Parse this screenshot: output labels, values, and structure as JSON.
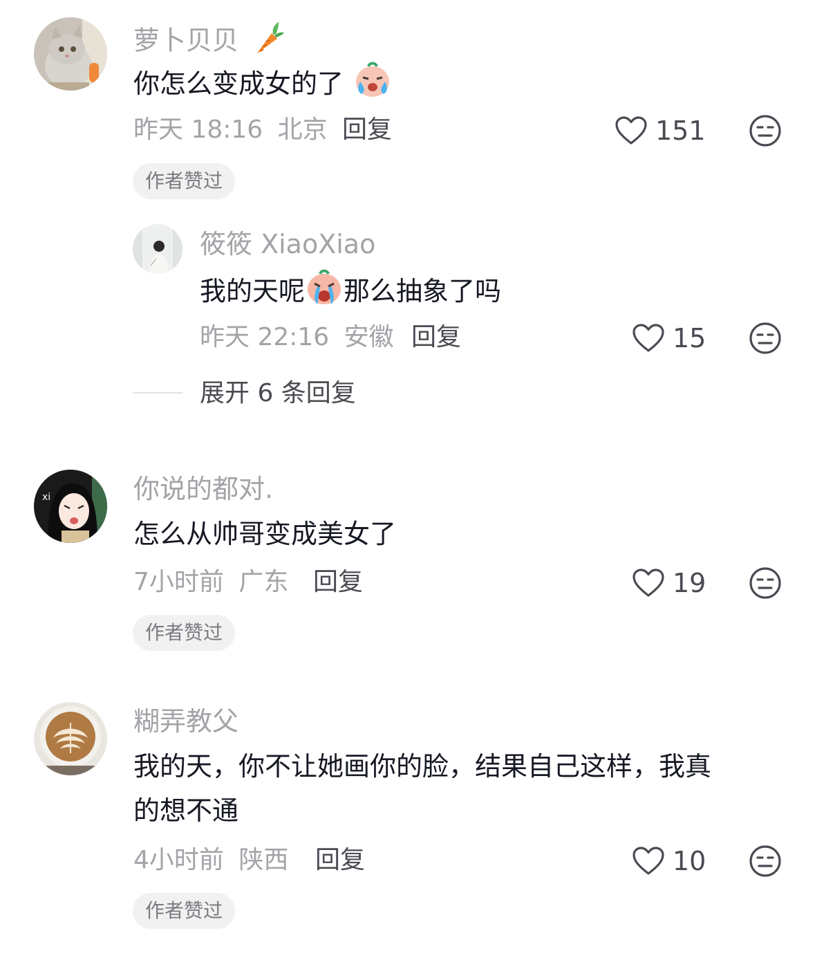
{
  "comments": [
    {
      "username": "萝卜贝贝",
      "text": "你怎么变成女的了",
      "time": "昨天 18:16",
      "location": "北京",
      "reply_label": "回复",
      "likes": "151",
      "badge": "作者赞过"
    },
    {
      "username": "你说的都对.",
      "text": "怎么从帅哥变成美女了",
      "time": "7小时前",
      "location": "广东",
      "reply_label": "回复",
      "likes": "19",
      "badge": "作者赞过"
    },
    {
      "username": "糊弄教父",
      "text_line1": "我的天，你不让她画你的脸，结果自己这样，我真",
      "text_line2": "的想不通",
      "time": "4小时前",
      "location": "陕西",
      "reply_label": "回复",
      "likes": "10",
      "badge": "作者赞过"
    }
  ],
  "reply": {
    "username": "筱筱 XiaoXiao",
    "text_before": "我的天呢",
    "text_after": "那么抽象了吗",
    "time": "昨天 22:16",
    "location": "安徽",
    "reply_label": "回复",
    "likes": "15"
  },
  "expand": {
    "label": "展开 6 条回复"
  },
  "icons": {
    "like": "heart-outline-icon",
    "dislike": "neutral-face-icon",
    "username_decoration": "carrot-emoji",
    "emoji_1": "crying-face-emoji",
    "emoji_2": "sobbing-face-emoji"
  },
  "colors": {
    "username": "#a3a3a8",
    "text": "#161823",
    "secondary": "#4a4a52",
    "badge_bg": "#f1f1f2"
  }
}
